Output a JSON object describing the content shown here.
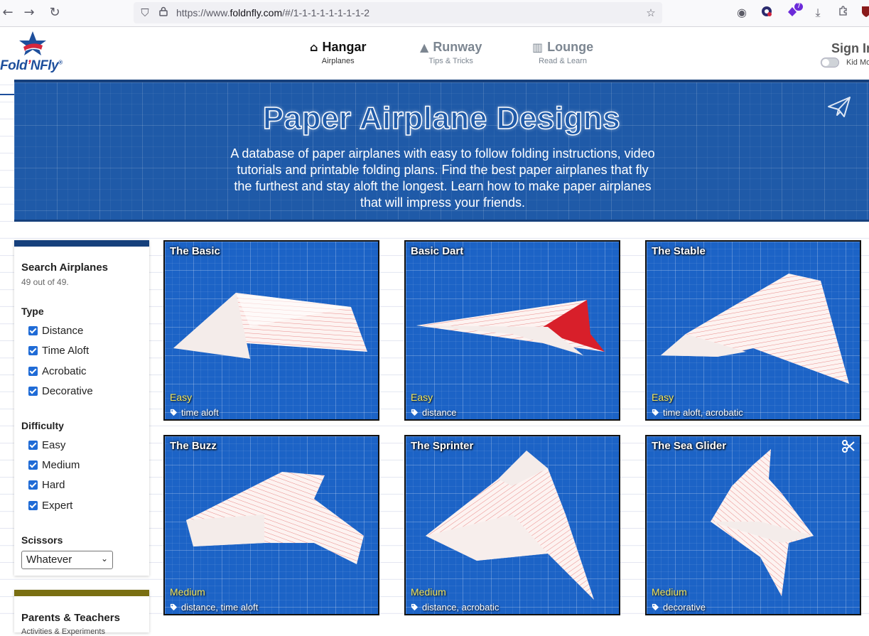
{
  "browser": {
    "url_prefix": "https://www.",
    "url_domain": "foldnfly.com",
    "url_suffix": "/#/1-1-1-1-1-1-1-1-2",
    "extension_badge": "7"
  },
  "header": {
    "logo_text_a": "Fold",
    "logo_text_apos": "’",
    "logo_text_b": "NFly",
    "logo_reg": "®",
    "nav": [
      {
        "label": "Hangar",
        "sub": "Airplanes",
        "icon": "hangar-icon"
      },
      {
        "label": "Runway",
        "sub": "Tips & Tricks",
        "icon": "runway-icon"
      },
      {
        "label": "Lounge",
        "sub": "Read & Learn",
        "icon": "book-icon"
      }
    ],
    "signin": "Sign In",
    "kid_mode": "Kid Mode"
  },
  "hero": {
    "title": "Paper Airplane Designs",
    "description": "A database of paper airplanes with easy to follow folding instructions, video tutorials and printable folding plans. Find the best paper airplanes that fly the furthest and stay aloft the longest. Learn how to make paper airplanes that will impress your friends."
  },
  "sidebar": {
    "title": "Search Airplanes",
    "count": "49 out of 49.",
    "type_heading": "Type",
    "types": [
      "Distance",
      "Time Aloft",
      "Acrobatic",
      "Decorative"
    ],
    "difficulty_heading": "Difficulty",
    "difficulties": [
      "Easy",
      "Medium",
      "Hard",
      "Expert"
    ],
    "scissors_heading": "Scissors",
    "scissors_value": "Whatever"
  },
  "sidebar2": {
    "title": "Parents & Teachers",
    "sub": "Activities & Experiments"
  },
  "cards": [
    {
      "title": "The Basic",
      "difficulty": "Easy",
      "tags": "time aloft"
    },
    {
      "title": "Basic Dart",
      "difficulty": "Easy",
      "tags": "distance"
    },
    {
      "title": "The Stable",
      "difficulty": "Easy",
      "tags": "time aloft, acrobatic"
    },
    {
      "title": "The Buzz",
      "difficulty": "Medium",
      "tags": "distance, time aloft"
    },
    {
      "title": "The Sprinter",
      "difficulty": "Medium",
      "tags": "distance, acrobatic"
    },
    {
      "title": "The Sea Glider",
      "difficulty": "Medium",
      "tags": "decorative",
      "scissors": true
    }
  ],
  "colors": {
    "brand_blue": "#1f5aa8",
    "card_blue": "#1c63c6",
    "difficulty_yellow": "#f2e45a",
    "parents_bar": "#7a6f12"
  }
}
